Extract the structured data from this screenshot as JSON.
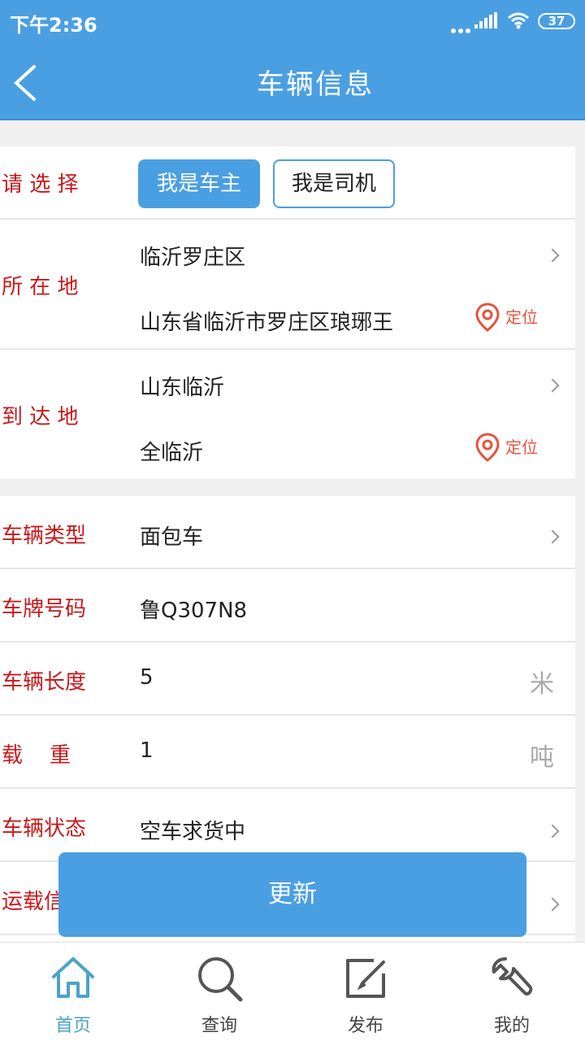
{
  "status_bar": {
    "time": "下午2:36",
    "battery": "37"
  },
  "header": {
    "title": "车辆信息"
  },
  "choose": {
    "label": "请 选 择",
    "options": [
      "我是车主",
      "我是司机"
    ],
    "selected": "我是车主"
  },
  "origin": {
    "label": "所 在 地",
    "city": "临沂罗庄区",
    "address": "山东省临沂市罗庄区琅琊王",
    "locate": "定位"
  },
  "destination": {
    "label": "到 达 地",
    "city": "山东临沂",
    "address": "全临沂",
    "locate": "定位"
  },
  "vehicle": {
    "type": {
      "label": "车辆类型",
      "value": "面包车"
    },
    "plate": {
      "label": "车牌号码",
      "value": "鲁Q307N8"
    },
    "length": {
      "label": "车辆长度",
      "value": "5",
      "unit": "米"
    },
    "load": {
      "label": "载    重",
      "value": "1",
      "unit": "吨"
    },
    "status": {
      "label": "车辆状态",
      "value": "空车求货中"
    },
    "transport": {
      "label": "运载信"
    }
  },
  "update_button": "更新",
  "tabs": [
    {
      "label": "首页",
      "icon": "home-icon",
      "active": true
    },
    {
      "label": "查询",
      "icon": "search-icon",
      "active": false
    },
    {
      "label": "发布",
      "icon": "edit-icon",
      "active": false
    },
    {
      "label": "我的",
      "icon": "wrench-icon",
      "active": false
    }
  ],
  "colors": {
    "primary": "#4a9fe3",
    "label_red": "#c8191b",
    "locate_orange": "#e4533b",
    "tab_active": "#4aa3c8"
  }
}
